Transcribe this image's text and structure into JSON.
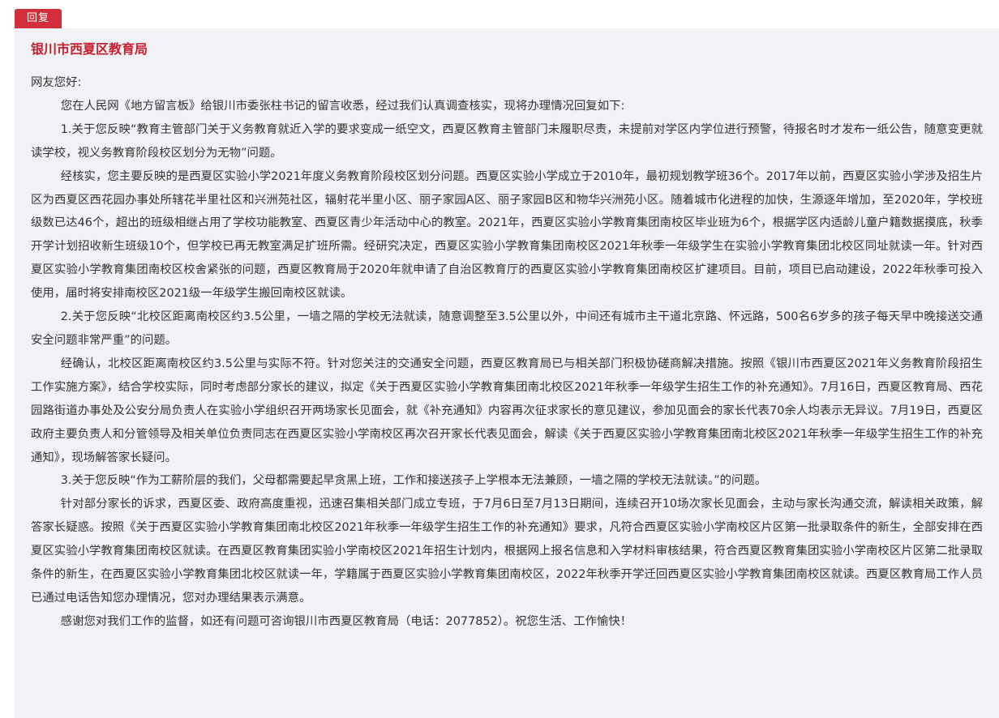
{
  "reply_tab": {
    "label": "回复"
  },
  "reply": {
    "organization": "银川市西夏区教育局",
    "greeting": "网友您好:",
    "paragraphs": [
      "您在人民网《地方留言板》给银川市委张柱书记的留言收悉，经过我们认真调查核实，现将办理情况回复如下:",
      "1.关于您反映“教育主管部门关于义务教育就近入学的要求变成一纸空文，西夏区教育主管部门未履职尽责，未提前对学区内学位进行预警，待报名时才发布一纸公告，随意变更就读学校，视义务教育阶段校区划分为无物”问题。",
      "经核实，您主要反映的是西夏区实验小学2021年度义务教育阶段校区划分问题。西夏区实验小学成立于2010年，最初规划教学班36个。2017年以前，西夏区实验小学涉及招生片区为西夏区西花园办事处所辖花半里社区和兴洲苑社区，辐射花半里小区、丽子家园A区、丽子家园B区和物华兴洲苑小区。随着城市化进程的加快，生源逐年增加，至2020年，学校班级数已达46个，超出的班级相继占用了学校功能教室、西夏区青少年活动中心的教室。2021年，西夏区实验小学教育集团南校区毕业班为6个，根据学区内适龄儿童户籍数据摸底，秋季开学计划招收新生班级10个，但学校已再无教室满足扩班所需。经研究决定，西夏区实验小学教育集团南校区2021年秋季一年级学生在实验小学教育集团北校区同址就读一年。针对西夏区实验小学教育集团南校区校舍紧张的问题，西夏区教育局于2020年就申请了自治区教育厅的西夏区实验小学教育集团南校区扩建项目。目前，项目已启动建设，2022年秋季可投入使用，届时将安排南校区2021级一年级学生搬回南校区就读。",
      "2.关于您反映“北校区距离南校区约3.5公里，一墙之隔的学校无法就读，随意调整至3.5公里以外，中间还有城市主干道北京路、怀远路，500名6岁多的孩子每天早中晚接送交通安全问题非常严重”的问题。",
      "经确认，北校区距离南校区约3.5公里与实际不符。针对您关注的交通安全问题，西夏区教育局已与相关部门积极协磋商解决措施。按照《银川市西夏区2021年义务教育阶段招生工作实施方案》，结合学校实际，同时考虑部分家长的建议，拟定《关于西夏区实验小学教育集团南北校区2021年秋季一年级学生招生工作的补充通知》。7月16日，西夏区教育局、西花园路街道办事处及公安分局负责人在实验小学组织召开两场家长见面会，就《补充通知》内容再次征求家长的意见建议，参加见面会的家长代表70余人均表示无异议。7月19日，西夏区政府主要负责人和分管领导及相关单位负责同志在西夏区实验小学南校区再次召开家长代表见面会，解读《关于西夏区实验小学教育集团南北校区2021年秋季一年级学生招生工作的补充通知》，现场解答家长疑问。",
      "3.关于您反映“作为工薪阶层的我们，父母都需要起早贪黑上班，工作和接送孩子上学根本无法兼顾，一墙之隔的学校无法就读。”的问题。",
      "针对部分家长的诉求，西夏区委、政府高度重视，迅速召集相关部门成立专班，于7月6日至7月13日期间，连续召开10场次家长见面会，主动与家长沟通交流，解读相关政策，解答家长疑惑。按照《关于西夏区实验小学教育集团南北校区2021年秋季一年级学生招生工作的补充通知》要求，凡符合西夏区实验小学南校区片区第一批录取条件的新生，全部安排在西夏区实验小学教育集团南校区就读。在西夏区教育集团实验小学南校区2021年招生计划内，根据网上报名信息和入学材料审核结果，符合西夏区教育集团实验小学南校区片区第二批录取条件的新生，在西夏区实验小学教育集团北校区就读一年，学籍属于西夏区实验小学教育集团南校区，2022年秋季开学迁回西夏区实验小学教育集团南校区就读。西夏区教育局工作人员已通过电话告知您办理情况，您对办理结果表示满意。",
      "感谢您对我们工作的监督，如还有问题可咨询银川市西夏区教育局（电话：2077852）。祝您生活、工作愉快！"
    ]
  },
  "colors": {
    "tab_background": "#d32f3a",
    "title_color": "#c8202c",
    "box_background": "#f1f2f6",
    "text_color": "#333333"
  }
}
